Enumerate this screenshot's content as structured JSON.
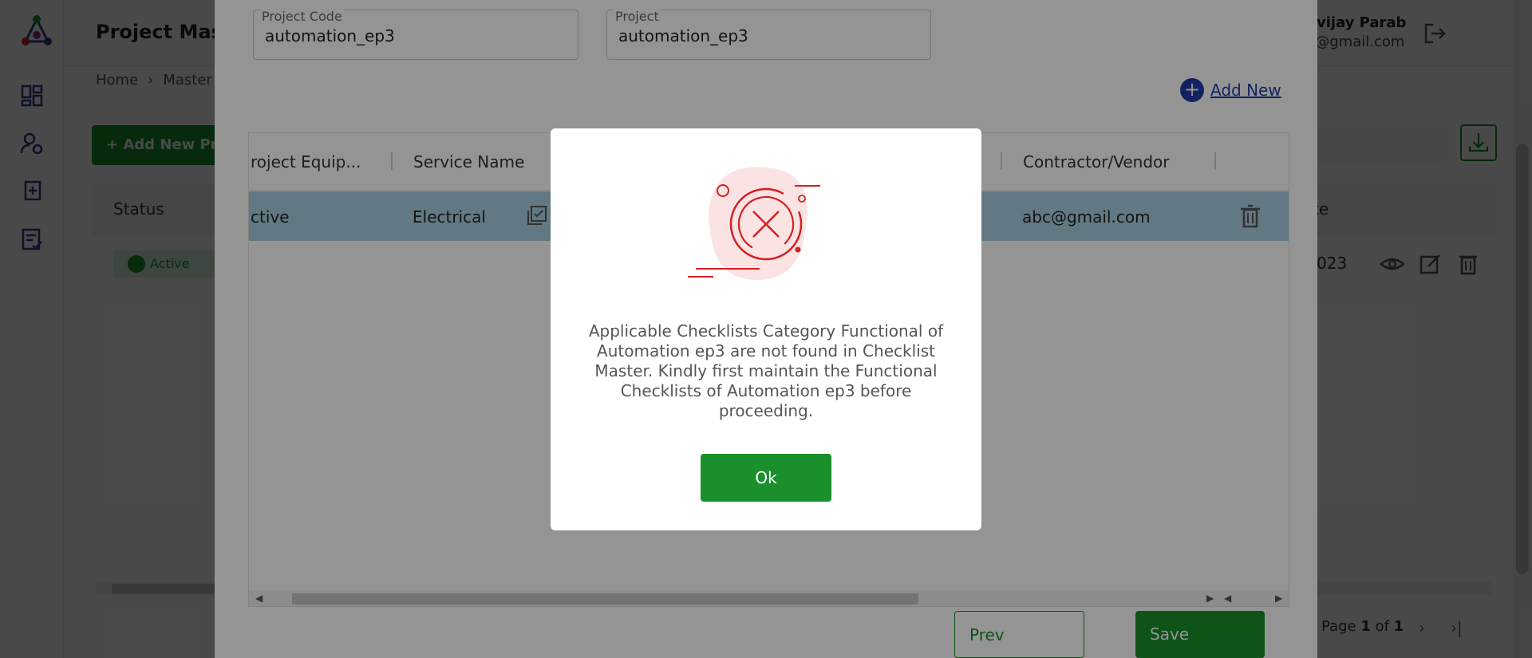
{
  "page": {
    "title": "Project Mast",
    "breadcrumb": {
      "home": "Home",
      "current": "Master"
    },
    "add_project_label": "+ Add New Pro",
    "user": {
      "name": "Digvijay Parab",
      "email": "dsp@gmail.com"
    },
    "table": {
      "status_header": "Status",
      "date_header": "te",
      "row_status": "Active",
      "row_date": "023"
    },
    "pagination": {
      "prefix": "Page ",
      "current": "1",
      "of": " of ",
      "total": "1"
    }
  },
  "drawer": {
    "project_code_label": "Project Code",
    "project_code_value": "automation_ep3",
    "project_label": "Project",
    "project_value": "automation_ep3",
    "add_new_label": "Add New",
    "columns": [
      "roject Equip...",
      "Service Name",
      "Contractor/Vendor"
    ],
    "row": {
      "status": "ctive",
      "service": "Electrical",
      "vendor": "abc@gmail.com"
    },
    "prev_label": "Prev",
    "save_label": "Save"
  },
  "dialog": {
    "icon": "error-x-icon",
    "message": "Applicable Checklists Category Functional of Automation ep3 are not found in Checklist Master. Kindly first maintain the Functional Checklists of Automation ep3 before proceeding.",
    "ok_label": "Ok"
  },
  "colors": {
    "primary_green": "#1a8f2b",
    "link_blue": "#1f3ca8",
    "error_red": "#d42020",
    "row_highlight": "#a9cfe0"
  }
}
